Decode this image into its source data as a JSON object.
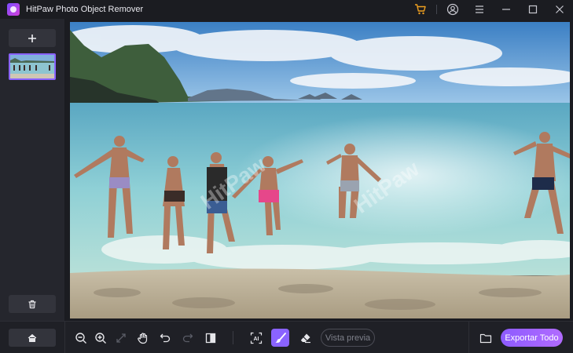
{
  "window": {
    "title": "HitPaw Photo Object Remover",
    "controls": [
      "cart-icon",
      "user-icon",
      "menu-icon",
      "minimize-icon",
      "maximize-icon",
      "close-icon"
    ]
  },
  "sidebar": {
    "add_label": "+",
    "thumbnails": [
      {
        "selected": true
      }
    ],
    "delete_icon": "trash-icon"
  },
  "canvas": {
    "watermark": "HitPaw"
  },
  "toolbar": {
    "home_icon": "home-icon",
    "tools": [
      "zoom-out-icon",
      "zoom-in-icon",
      "fit-screen-icon",
      "hand-icon",
      "undo-icon",
      "redo-icon",
      "compare-icon",
      "ai-select-icon",
      "brush-icon",
      "eraser-icon"
    ],
    "active_tool": "brush-icon",
    "preview_label": "Vista previa",
    "export_label": "Exportar Todo"
  },
  "colors": {
    "accent": "#8a63ff",
    "background": "#1b1c21",
    "panel": "#25262d"
  }
}
